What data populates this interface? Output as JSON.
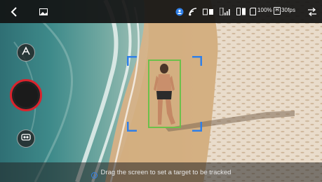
{
  "status_bar": {
    "battery_percent": "100%",
    "resolution_badge": "H",
    "frame_rate": "30fps",
    "signal_bars": 4,
    "icons": [
      "back-arrow-icon",
      "gallery-icon",
      "track-mode-icon",
      "gps-icon",
      "remote-controller-icon",
      "signal-strength-icon",
      "battery-icon",
      "sd-card-icon",
      "settings-icon"
    ]
  },
  "side_controls": {
    "icons": [
      "camera-switch-icon",
      "shutter-button",
      "lens-settings-icon"
    ]
  },
  "tracking": {
    "target_box_color": "#6cc04a",
    "frame_color": "#2f7fe8"
  },
  "hint": {
    "text": "Drag the screen to set a target to be tracked",
    "icon": "info-icon"
  },
  "colors": {
    "shutter_ring": "#d9232d",
    "accent": "#2f7fe8"
  }
}
